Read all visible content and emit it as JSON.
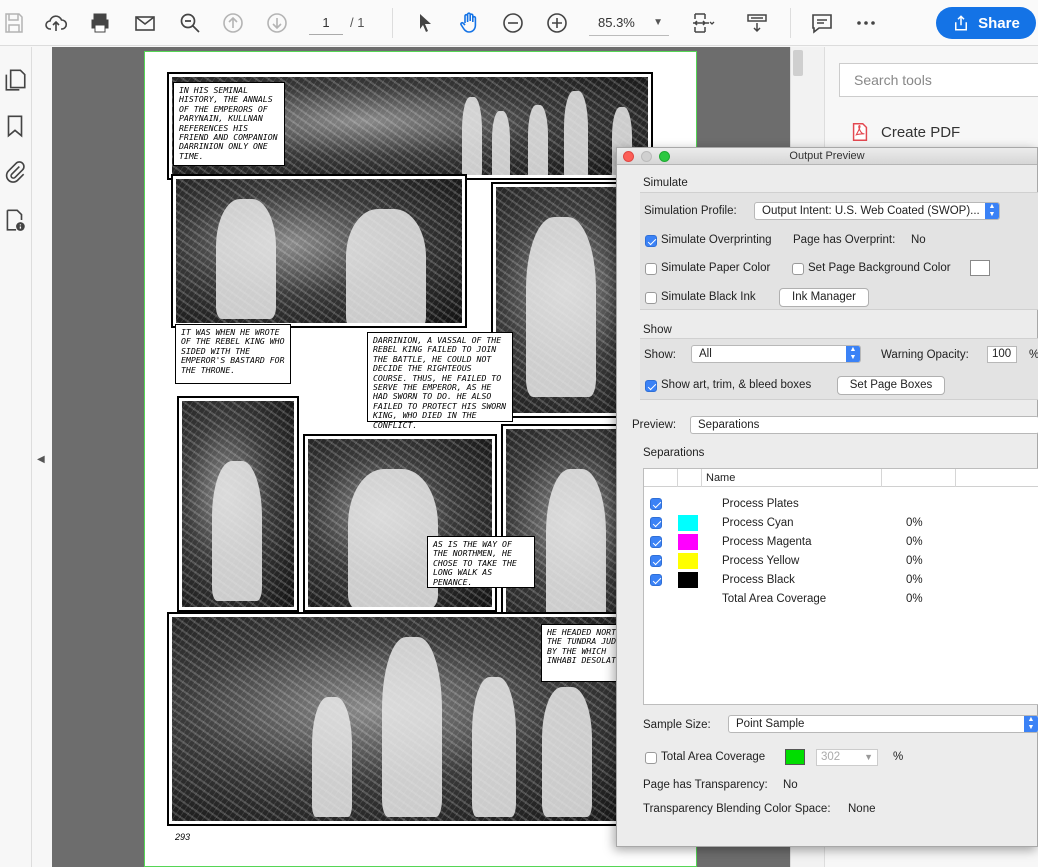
{
  "toolbar": {
    "page_current": "1",
    "page_total": "/ 1",
    "zoom": "85.3%",
    "share_label": "Share"
  },
  "tools_pane": {
    "search_placeholder": "Search tools",
    "create_pdf_label": "Create PDF"
  },
  "comic": {
    "captions": [
      "In his seminal history, The Annals of the Emperors of Parynain, Kullnan references his friend and companion Darrinion only one time.",
      "It was when he wrote of the rebel king who sided with the emperor's bastard for the throne.",
      "Darrinion, a vassal of the rebel king failed to join the battle, he could not decide the righteous course. Thus, he failed to serve the emperor, as he had sworn to do. He also failed to protect his sworn king, who died in the conflict.",
      "As is the way of the northmen, he chose to take the long walk as penance.",
      "He headed nort the tundra judged by the which inhabi desolate"
    ],
    "page_number": "293"
  },
  "dialog": {
    "title": "Output Preview",
    "simulate_header": "Simulate",
    "simulation_profile_label": "Simulation Profile:",
    "simulation_profile_value": "Output Intent: U.S. Web Coated (SWOP)...",
    "simulate_overprinting_label": "Simulate Overprinting",
    "simulate_overprinting_checked": true,
    "page_has_overprint_label": "Page has Overprint:",
    "page_has_overprint_value": "No",
    "simulate_paper_color_label": "Simulate Paper Color",
    "set_page_bg_label": "Set Page Background Color",
    "simulate_black_ink_label": "Simulate Black Ink",
    "ink_manager_label": "Ink Manager",
    "show_header": "Show",
    "show_label": "Show:",
    "show_value": "All",
    "warning_opacity_label": "Warning Opacity:",
    "warning_opacity_value": "100",
    "warning_opacity_unit": "%",
    "show_boxes_label": "Show art, trim, & bleed boxes",
    "show_boxes_checked": true,
    "set_page_boxes_label": "Set Page Boxes",
    "preview_label": "Preview:",
    "preview_value": "Separations",
    "separations_header": "Separations",
    "table_name_header": "Name",
    "separations": [
      {
        "name": "Process Plates",
        "percent": "",
        "color": "",
        "checked": true
      },
      {
        "name": "Process Cyan",
        "percent": "0%",
        "color": "#00ffff",
        "checked": true
      },
      {
        "name": "Process Magenta",
        "percent": "0%",
        "color": "#ff00ff",
        "checked": true
      },
      {
        "name": "Process Yellow",
        "percent": "0%",
        "color": "#ffff00",
        "checked": true
      },
      {
        "name": "Process Black",
        "percent": "0%",
        "color": "#000000",
        "checked": true
      },
      {
        "name": "Total Area Coverage",
        "percent": "0%",
        "color": "",
        "checked": false
      }
    ],
    "sample_size_label": "Sample Size:",
    "sample_size_value": "Point Sample",
    "total_area_coverage_label": "Total Area Coverage",
    "total_area_coverage_swatch": "#00dd00",
    "total_area_coverage_value": "302",
    "total_area_coverage_unit": "%",
    "page_has_transparency_label": "Page has Transparency:",
    "page_has_transparency_value": "No",
    "blending_space_label": "Transparency Blending Color Space:",
    "blending_space_value": "None"
  },
  "colors": {
    "accent": "#1473e6",
    "page_border": "#55d655"
  }
}
